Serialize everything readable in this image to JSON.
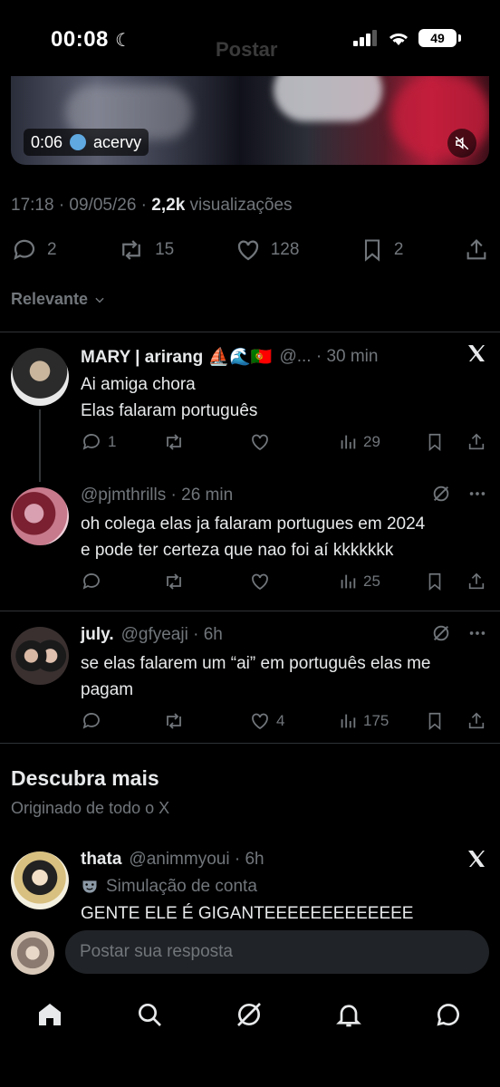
{
  "status": {
    "time": "00:08",
    "battery": "49",
    "ghost_title": "Postar"
  },
  "video": {
    "duration": "0:06",
    "source": "acervy"
  },
  "tweet_meta": {
    "time_date": "17:18 · 09/05/26 · ",
    "views_count": "2,2k",
    "views_label": " visualizações"
  },
  "tweet_actions": {
    "replies": "2",
    "retweets": "15",
    "likes": "128",
    "bookmarks": "2"
  },
  "sort": {
    "label": "Relevante"
  },
  "replies": [
    {
      "name": "MARY | arirang ⛵🌊🇵🇹",
      "handle": "@... · 30 min",
      "line1": "Ai amiga chora",
      "line2": "Elas falaram português",
      "reply": "1",
      "retweet": "",
      "like": "",
      "views": "29"
    },
    {
      "name": "",
      "handle": "@pjmthrills · 26 min",
      "line1": "oh colega elas ja falaram portugues em 2024",
      "line2": "e pode ter certeza que nao foi aí kkkkkkk",
      "reply": "",
      "retweet": "",
      "like": "",
      "views": "25"
    },
    {
      "name": "july.",
      "handle": "@gfyeaji · 6h",
      "line1": "se elas falarem um “ai” em português elas me",
      "line2": "pagam",
      "reply": "",
      "retweet": "",
      "like": "4",
      "views": "175"
    }
  ],
  "discover": {
    "title": "Descubra mais",
    "subtitle": "Originado de todo o X",
    "post": {
      "name": "thata",
      "handle": "@animmyoui · 6h",
      "label": "Simulação de conta",
      "text": "GENTE ELE É GIGANTEEEEEEEEEEEEE"
    }
  },
  "reply_bar": {
    "placeholder": "Postar sua resposta"
  },
  "colors": {
    "background": "#000000",
    "text": "#e7e9ea",
    "muted": "#71767b",
    "divider": "#2f3336"
  }
}
